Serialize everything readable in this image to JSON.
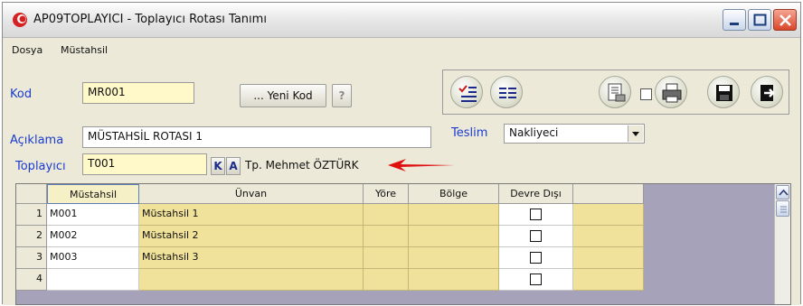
{
  "window": {
    "title": "AP09TOPLAYICI - Toplayıcı Rotası Tanımı"
  },
  "menu": [
    "Dosya",
    "Müstahsil"
  ],
  "form": {
    "kod_label": "Kod",
    "kod_value": "MR001",
    "yeni_kod_button": "... Yeni Kod",
    "help_button": "?",
    "aciklama_label": "Açıklama",
    "aciklama_value": "MÜSTAHSİL ROTASI 1",
    "teslim_label": "Teslim",
    "teslim_value": "Nakliyeci",
    "toplayici_label": "Toplayıcı",
    "toplayici_value": "T001",
    "k_button": "K",
    "a_button": "A",
    "toplayici_name": "Tp. Mehmet ÖZTÜRK"
  },
  "toolbar": {
    "icons": [
      "checklist-icon",
      "list-icon",
      "report-icon",
      "print-icon",
      "save-icon",
      "exit-icon"
    ],
    "checkbox_checked": false
  },
  "grid": {
    "columns": [
      "",
      "Müstahsil",
      "Ünvan",
      "Yöre",
      "Bölge",
      "Devre Dışı",
      ""
    ],
    "rows": [
      {
        "num": "1",
        "mustahsil": "M001",
        "unvan": "Müstahsil 1",
        "yore": "",
        "bolge": "",
        "devre_disi": false
      },
      {
        "num": "2",
        "mustahsil": "M002",
        "unvan": "Müstahsil 2",
        "yore": "",
        "bolge": "",
        "devre_disi": false
      },
      {
        "num": "3",
        "mustahsil": "M003",
        "unvan": "Müstahsil 3",
        "yore": "",
        "bolge": "",
        "devre_disi": false
      },
      {
        "num": "4",
        "mustahsil": "",
        "unvan": "",
        "yore": "",
        "bolge": "",
        "devre_disi": false
      }
    ]
  },
  "colors": {
    "label_blue": "#1a3cd0",
    "grid_yellow": "#f0e29a",
    "arrow_red": "#e01010",
    "grid_empty": "#a6a2ba"
  }
}
